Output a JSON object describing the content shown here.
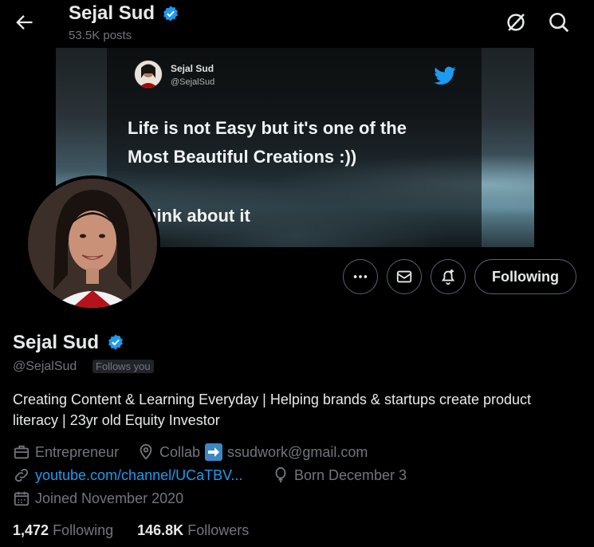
{
  "header": {
    "name": "Sejal Sud",
    "posts": "53.5K posts"
  },
  "banner": {
    "card_name": "Sejal Sud",
    "card_handle": "@SejalSud",
    "line1": "Life is not Easy but it's one of the",
    "line2": "Most Beautiful Creations :))",
    "line3": "hink about it"
  },
  "actions": {
    "follow_label": "Following"
  },
  "profile": {
    "name": "Sejal Sud",
    "handle": "@SejalSud",
    "follows_you": "Follows you",
    "bio": "Creating Content & Learning Everyday | Helping brands & startups create product literacy | 23yr old Equity Investor",
    "category": "Entrepreneur",
    "location": "Collab",
    "location_email": "ssudwork@gmail.com",
    "website": "youtube.com/channel/UCaTBV...",
    "birthday": "Born December 3",
    "joined": "Joined November 2020"
  },
  "stats": {
    "following_count": "1,472",
    "following_label": "Following",
    "followers_count": "146.8K",
    "followers_label": "Followers"
  },
  "colors": {
    "accent": "#1d9bf0",
    "muted": "#71767b",
    "text": "#e7e9ea"
  }
}
